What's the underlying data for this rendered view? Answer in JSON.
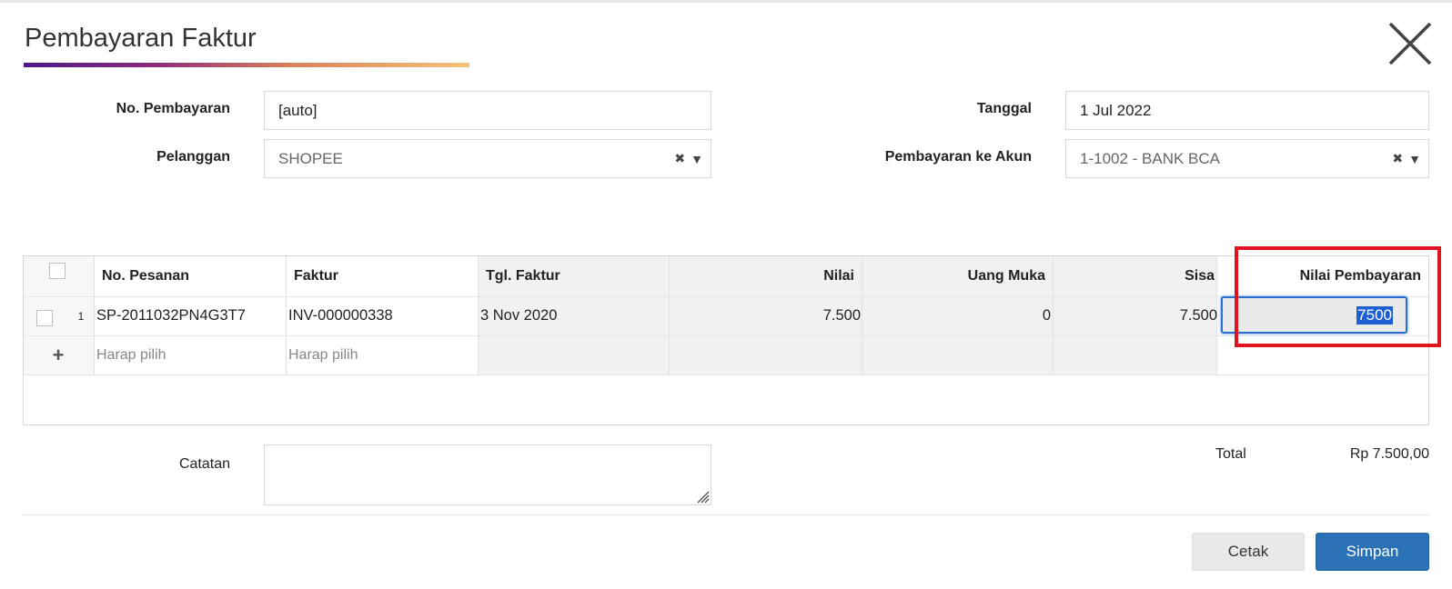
{
  "dialog": {
    "title": "Pembayaran Faktur"
  },
  "form": {
    "payment_no_label": "No. Pembayaran",
    "payment_no_value": "[auto]",
    "date_label": "Tanggal",
    "date_value": "1 Jul 2022",
    "customer_label": "Pelanggan",
    "customer_value": "SHOPEE",
    "account_label": "Pembayaran ke Akun",
    "account_value": "1-1002 - BANK BCA",
    "notes_label": "Catatan",
    "notes_value": ""
  },
  "table": {
    "headers": {
      "order_no": "No. Pesanan",
      "invoice": "Faktur",
      "invoice_date": "Tgl. Faktur",
      "value": "Nilai",
      "down_payment": "Uang Muka",
      "remaining": "Sisa",
      "payment_value": "Nilai Pembayaran"
    },
    "rows": [
      {
        "index": "1",
        "order_no": "SP-2011032PN4G3T7",
        "invoice": "INV-000000338",
        "invoice_date": "3 Nov 2020",
        "value": "7.500",
        "down_payment": "0",
        "remaining": "7.500",
        "payment_value": "7500"
      }
    ],
    "new_row": {
      "add_symbol": "+",
      "order_placeholder": "Harap pilih",
      "invoice_placeholder": "Harap pilih"
    }
  },
  "summary": {
    "total_label": "Total",
    "total_value": "Rp 7.500,00"
  },
  "buttons": {
    "print": "Cetak",
    "save": "Simpan"
  },
  "colors": {
    "primary": "#2a72b5",
    "highlight": "#e0141e",
    "selection": "#1f5fd6"
  }
}
